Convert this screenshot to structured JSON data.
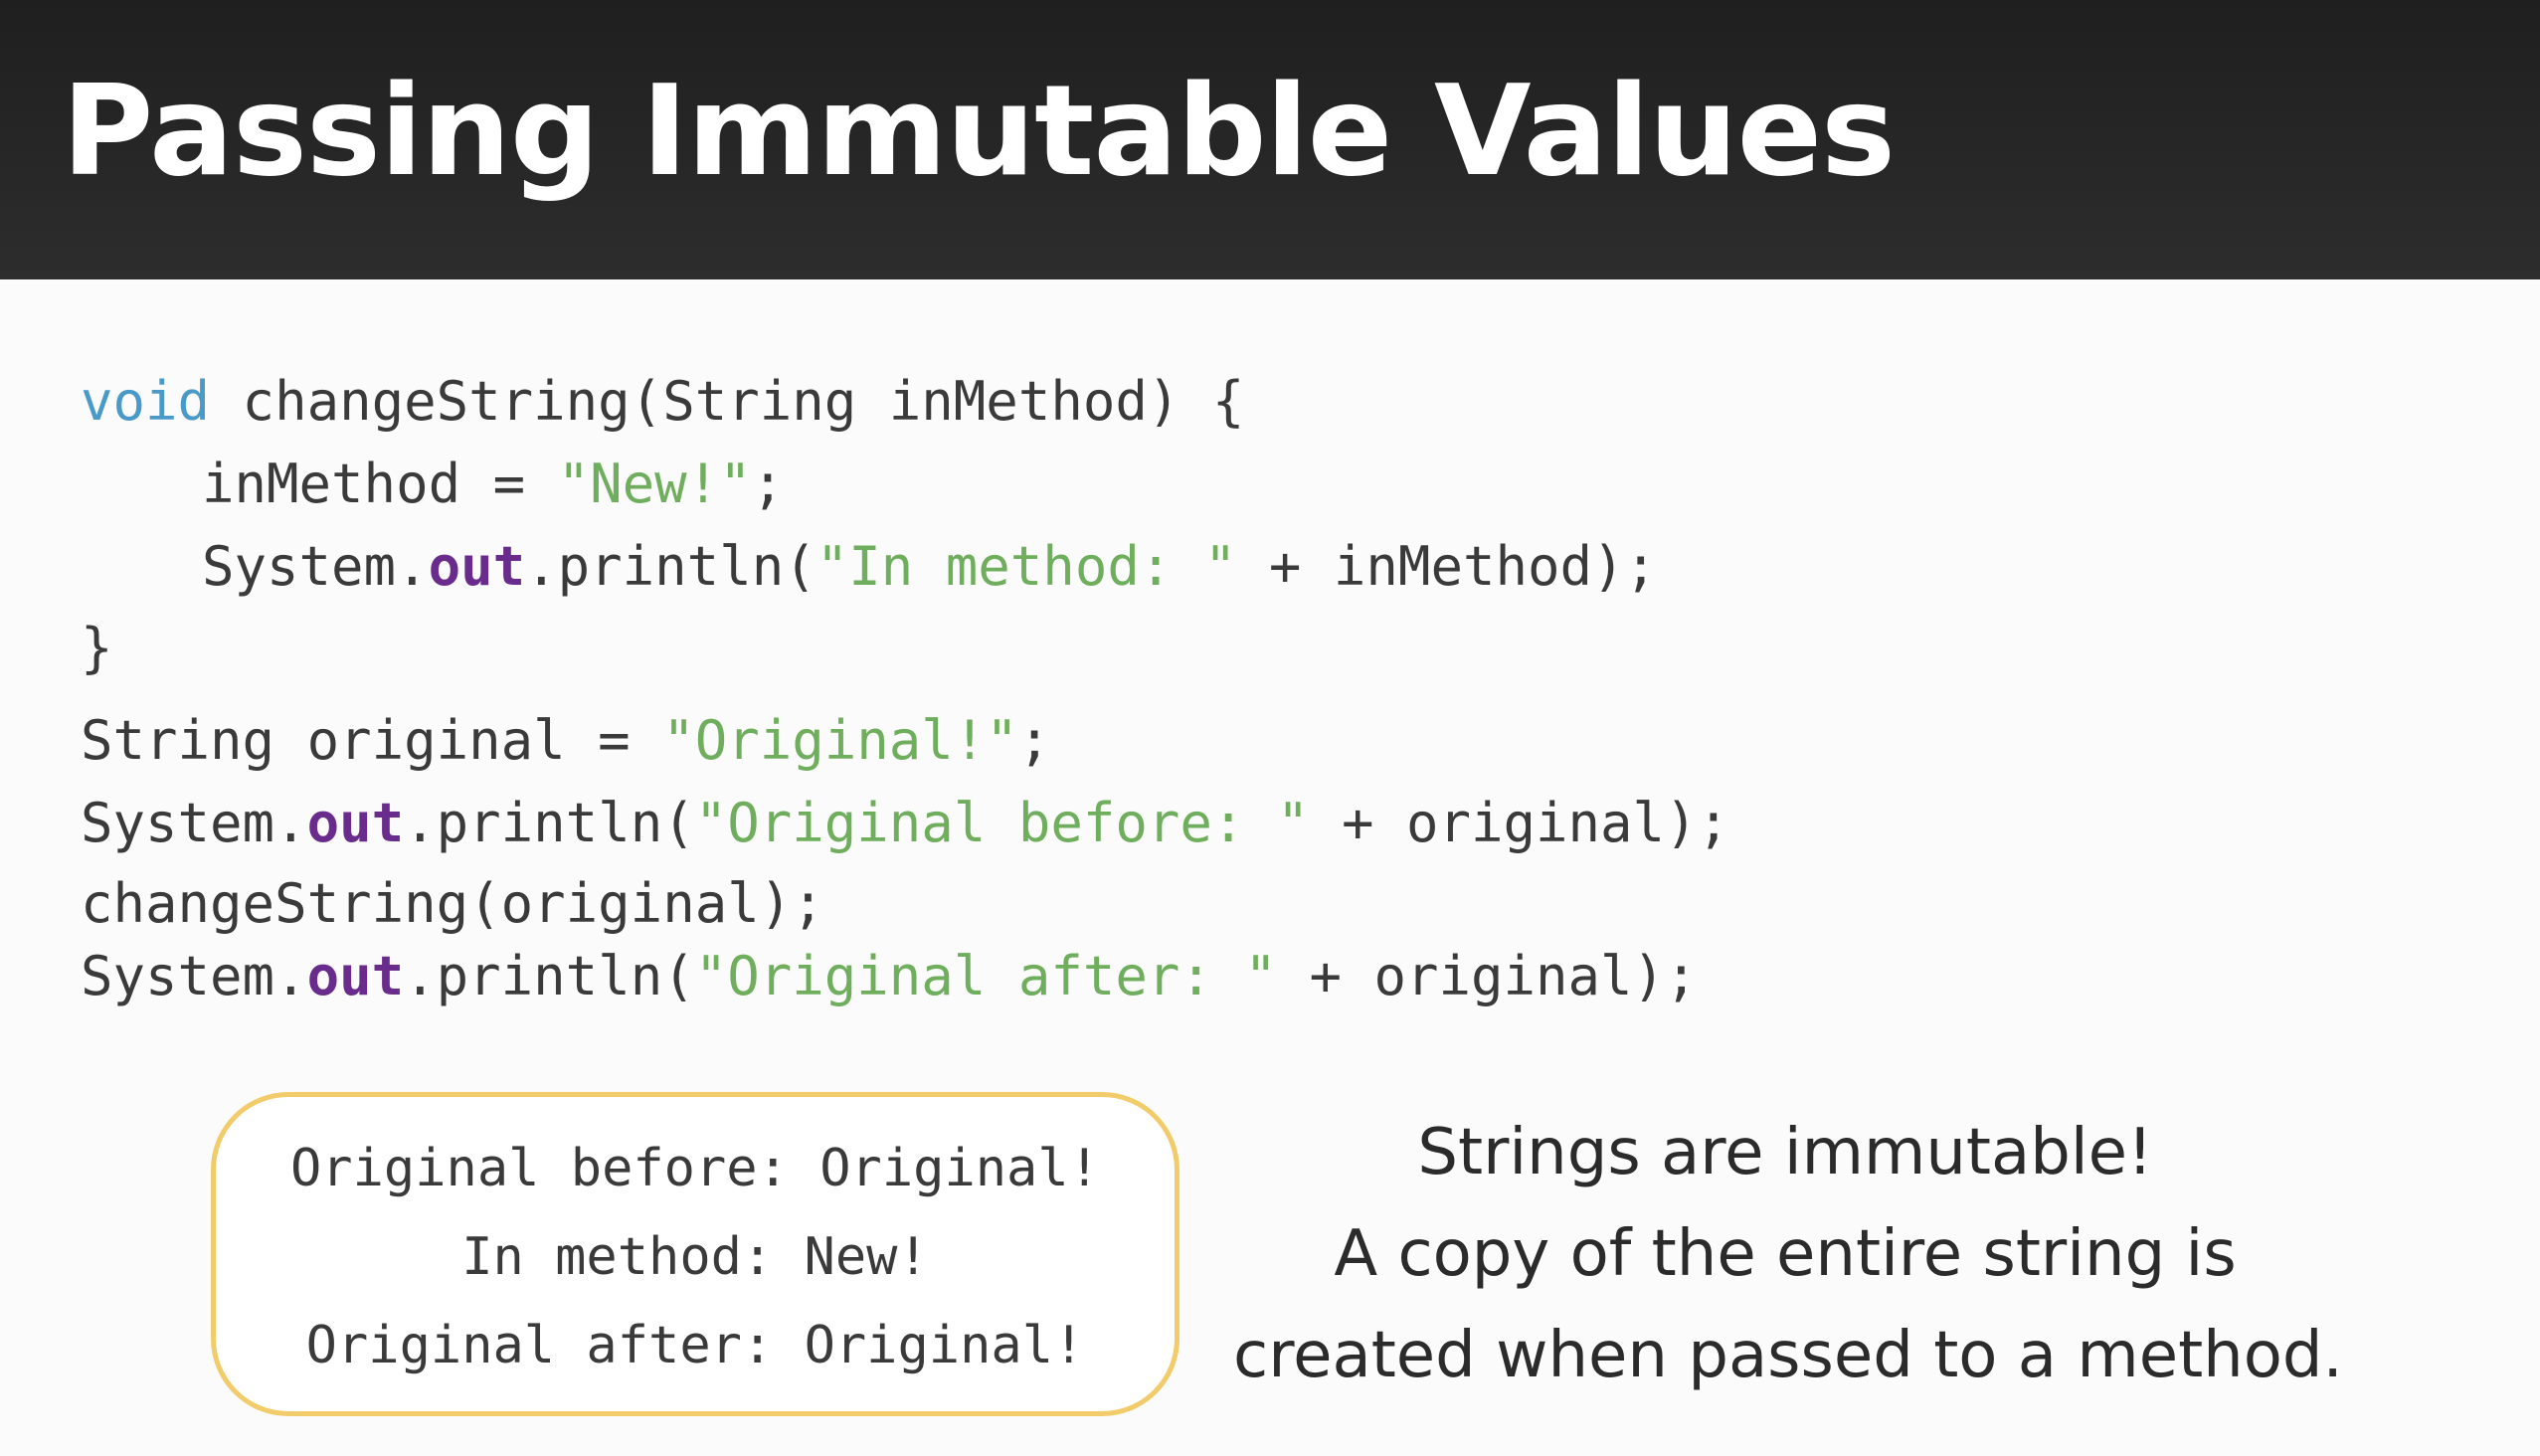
{
  "slide": {
    "title": "Passing Immutable Values"
  },
  "code": {
    "line1": {
      "keyword": "void",
      "rest": " changeString(String inMethod) {"
    },
    "line2": {
      "prefix": "inMethod = ",
      "string": "\"New!\"",
      "suffix": ";"
    },
    "line3": {
      "prefix": "System.",
      "field": "out",
      "mid": ".println(",
      "string": "\"In method: \"",
      "suffix": " + inMethod);"
    },
    "line4": {
      "text": "}"
    },
    "line5": {
      "prefix": "String original = ",
      "string": "\"Original!\"",
      "suffix": ";"
    },
    "line6": {
      "prefix": "System.",
      "field": "out",
      "mid": ".println(",
      "string": "\"Original before: \"",
      "suffix": " + original);"
    },
    "line7": {
      "text": "changeString(original);"
    },
    "line8": {
      "prefix": "System.",
      "field": "out",
      "mid": ".println(",
      "string": "\"Original after: \"",
      "suffix": " + original);"
    }
  },
  "output": {
    "lines": [
      "Original before: Original!",
      "In method: New!",
      "Original after: Original!"
    ]
  },
  "note": {
    "lines": [
      "Strings are immutable!",
      "A copy of the entire string is",
      "created when passed to a method."
    ]
  },
  "colors": {
    "header_bg": "#262626",
    "keyword": "#4a9ac9",
    "field": "#6a2c8c",
    "string": "#6fae5c",
    "box_border": "#f2cc6a"
  }
}
